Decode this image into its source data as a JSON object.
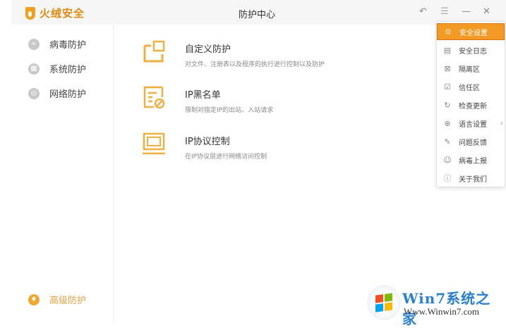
{
  "app": {
    "name": "火绒安全",
    "title": "防护中心"
  },
  "titlebar": {
    "back_icon": "↶",
    "menu_icon": "☰",
    "minimize_icon": "—",
    "close_icon": "✕"
  },
  "sidebar": {
    "items": [
      {
        "label": "病毒防护",
        "icon": "+"
      },
      {
        "label": "系统防护",
        "icon": "▦"
      },
      {
        "label": "网络防护",
        "icon": "◎"
      }
    ],
    "advanced": {
      "label": "高级防护",
      "icon": "♦"
    }
  },
  "features": [
    {
      "title": "自定义防护",
      "desc": "对文件、注册表以及程序的执行进行控制以及防护"
    },
    {
      "title": "IP黑名单",
      "desc": "限制对指定IP的出站、入站请求"
    },
    {
      "title": "IP协议控制",
      "desc": "在IP协议层进行网络访问控制"
    }
  ],
  "menu": {
    "items": [
      {
        "label": "安全设置",
        "icon": "⚙"
      },
      {
        "label": "安全日志",
        "icon": "▤"
      },
      {
        "label": "隔离区",
        "icon": "⊠"
      },
      {
        "label": "信任区",
        "icon": "☑"
      },
      {
        "label": "检查更新",
        "icon": "↻"
      },
      {
        "label": "语言设置",
        "icon": "⊕",
        "submenu": "›"
      },
      {
        "label": "问题反馈",
        "icon": "✎"
      },
      {
        "label": "病毒上报",
        "icon": "☺"
      },
      {
        "label": "关于我们",
        "icon": "ⓘ"
      }
    ]
  },
  "watermark": {
    "title": "Win7系统之家",
    "url": "Www.Winwin7.com"
  },
  "colors": {
    "accent": "#f39a25",
    "icon_orange": "#f0b040"
  }
}
